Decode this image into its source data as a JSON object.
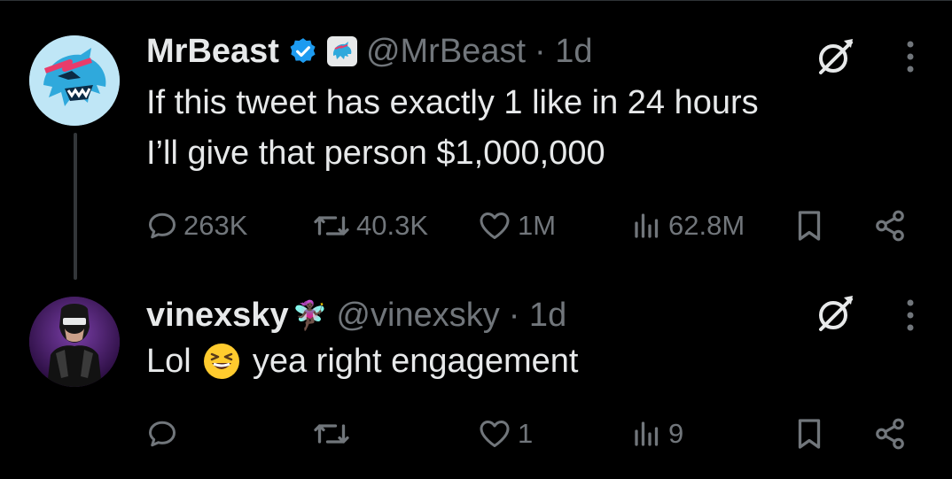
{
  "tweets": [
    {
      "name": "MrBeast",
      "handle": "@MrBeast",
      "time": "· 1d",
      "verified": true,
      "text_lines": [
        "If this tweet has exactly 1 like in 24 hours",
        "I’ll give that person $1,000,000"
      ],
      "replies": "263K",
      "retweets": "40.3K",
      "likes": "1M",
      "views": "62.8M"
    },
    {
      "name": "vinexsky",
      "name_emoji": "🧚🏿‍♀️",
      "handle": "@vinexsky",
      "time": "· 1d",
      "text_before": "Lol",
      "text_after": "yea right engagement",
      "replies": "",
      "retweets": "",
      "likes": "1",
      "views": "9"
    }
  ],
  "icons": {
    "verified": "verified-badge-icon",
    "grok": "grok-icon",
    "more": "more-vertical-icon",
    "reply": "reply-icon",
    "retweet": "retweet-icon",
    "like": "heart-icon",
    "views": "views-icon",
    "bookmark": "bookmark-icon",
    "share": "share-icon"
  },
  "colors": {
    "background": "#000000",
    "text": "#e7e9ea",
    "muted": "#71767b",
    "verified": "#1d9bf0"
  }
}
